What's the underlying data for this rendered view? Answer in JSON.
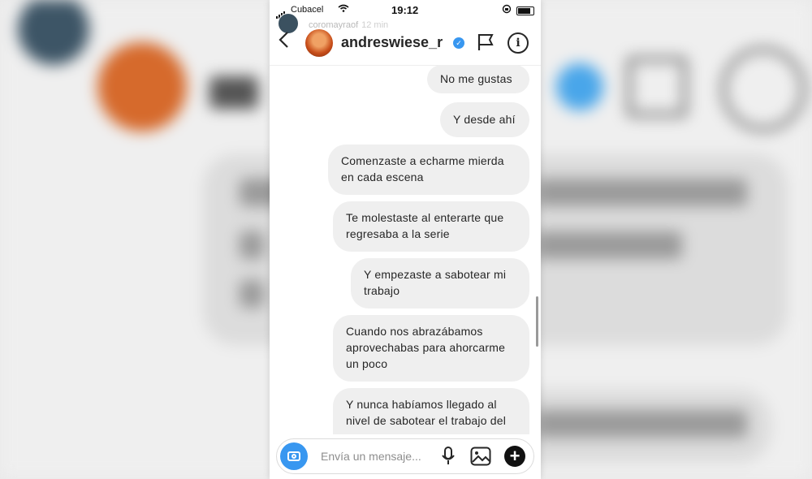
{
  "status_bar": {
    "carrier": "Cubacel",
    "time": "19:12"
  },
  "story": {
    "username": "coromayraof",
    "time_ago": "12 min"
  },
  "header": {
    "username": "andreswiese_r"
  },
  "messages": [
    "No me gustas",
    "Y desde ahí",
    "Comenzaste a echarme mierda en cada escena",
    "Te molestaste al enterarte que regresaba a la serie",
    "Y empezaste a sabotear mi trabajo",
    "Cuando nos abrazábamos aprovechabas para ahorcarme un poco",
    "Y nunca habíamos llegado al nivel de sabotear el trabajo del"
  ],
  "composer": {
    "placeholder": "Envía un mensaje..."
  },
  "colors": {
    "accent_blue": "#3897f0",
    "bubble_gray": "#efefef"
  },
  "icons": [
    "back-icon",
    "verified-icon",
    "flag-icon",
    "info-icon",
    "camera-icon",
    "mic-icon",
    "gallery-icon",
    "plus-icon"
  ]
}
